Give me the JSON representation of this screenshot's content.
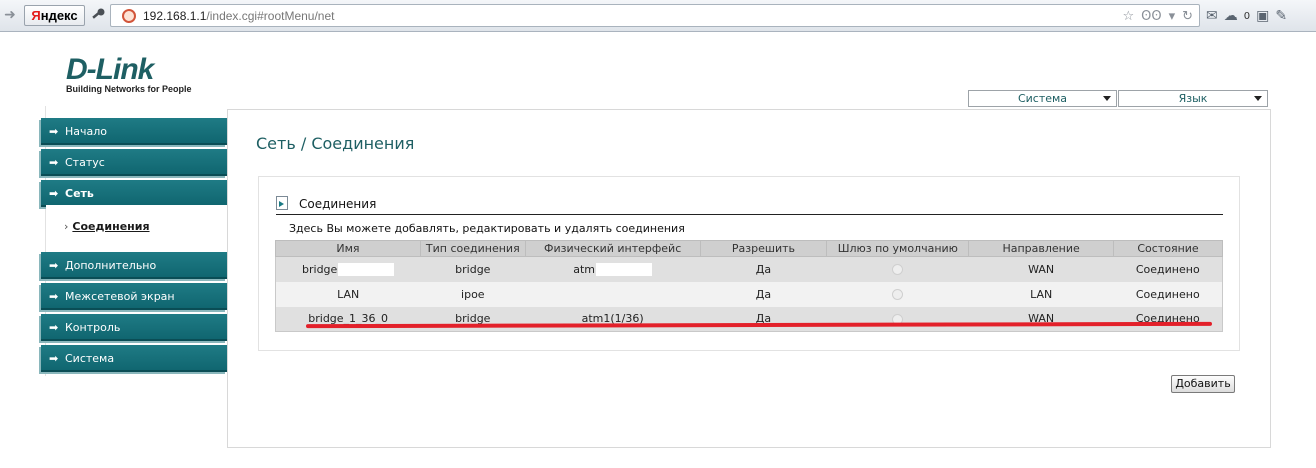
{
  "browser": {
    "yandex_prefix": "Я",
    "yandex_rest": "ндекс",
    "url_host": "192.168.1.1",
    "url_path": "/index.cgi#rootMenu/net",
    "notifications_count": "0",
    "cloud_count": "0"
  },
  "logo": {
    "title": "D-Link",
    "tagline": "Building Networks for People"
  },
  "top_selects": {
    "system": "Система",
    "language": "Язык"
  },
  "sidebar": {
    "items": [
      {
        "label": "Начало"
      },
      {
        "label": "Статус"
      },
      {
        "label": "Сеть"
      },
      {
        "label": "Дополнительно"
      },
      {
        "label": "Межсетевой экран"
      },
      {
        "label": "Контроль"
      },
      {
        "label": "Система"
      }
    ],
    "sub_item": "Соединения"
  },
  "page": {
    "title": "Сеть /  Соединения",
    "section_title": "Соединения",
    "section_desc": "Здесь Вы можете добавлять, редактировать и удалять соединения",
    "add_button": "Добавить"
  },
  "table": {
    "headers": [
      "Имя",
      "Тип соединения",
      "Физический интерфейс",
      "Разрешить",
      "Шлюз по умолчанию",
      "Направление",
      "Состояние"
    ],
    "rows": [
      {
        "name": "bridge",
        "type": "bridge",
        "iface": "atm",
        "enable": "Да",
        "direction": "WAN",
        "state": "Соединено"
      },
      {
        "name": "LAN",
        "type": "ipoe",
        "iface": "",
        "enable": "Да",
        "direction": "LAN",
        "state": "Соединено"
      },
      {
        "name": "bridge_1_36_0",
        "type": "bridge",
        "iface": "atm1(1/36)",
        "enable": "Да",
        "direction": "WAN",
        "state": "Соединено"
      }
    ]
  },
  "colors": {
    "nav_teal": "#17717b",
    "title_teal": "#1e5f63",
    "annotation_red": "#e3202a"
  }
}
